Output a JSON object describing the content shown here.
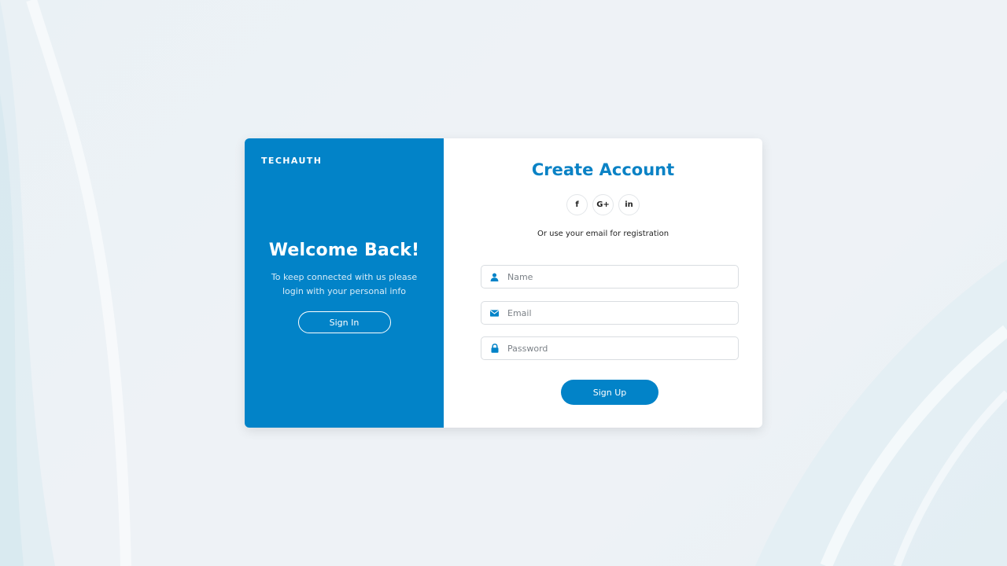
{
  "brand": "TECHAUTH",
  "left_panel": {
    "heading": "Welcome Back!",
    "message": "To keep connected with us please login with your personal info",
    "signin_label": "Sign In"
  },
  "right_panel": {
    "title": "Create Account",
    "socials": [
      {
        "icon": "facebook-icon",
        "label": "f"
      },
      {
        "icon": "google-plus-icon",
        "label": "G+"
      },
      {
        "icon": "linkedin-icon",
        "label": "in"
      }
    ],
    "subtext": "Or use your email for registration",
    "fields": {
      "name": {
        "placeholder": "Name",
        "value": "",
        "icon": "user-icon"
      },
      "email": {
        "placeholder": "Email",
        "value": "",
        "icon": "envelope-icon"
      },
      "password": {
        "placeholder": "Password",
        "value": "",
        "icon": "lock-icon"
      }
    },
    "signup_label": "Sign Up"
  },
  "colors": {
    "primary": "#0283c8",
    "title": "#0a82c5",
    "background": "#ecf1f5"
  }
}
